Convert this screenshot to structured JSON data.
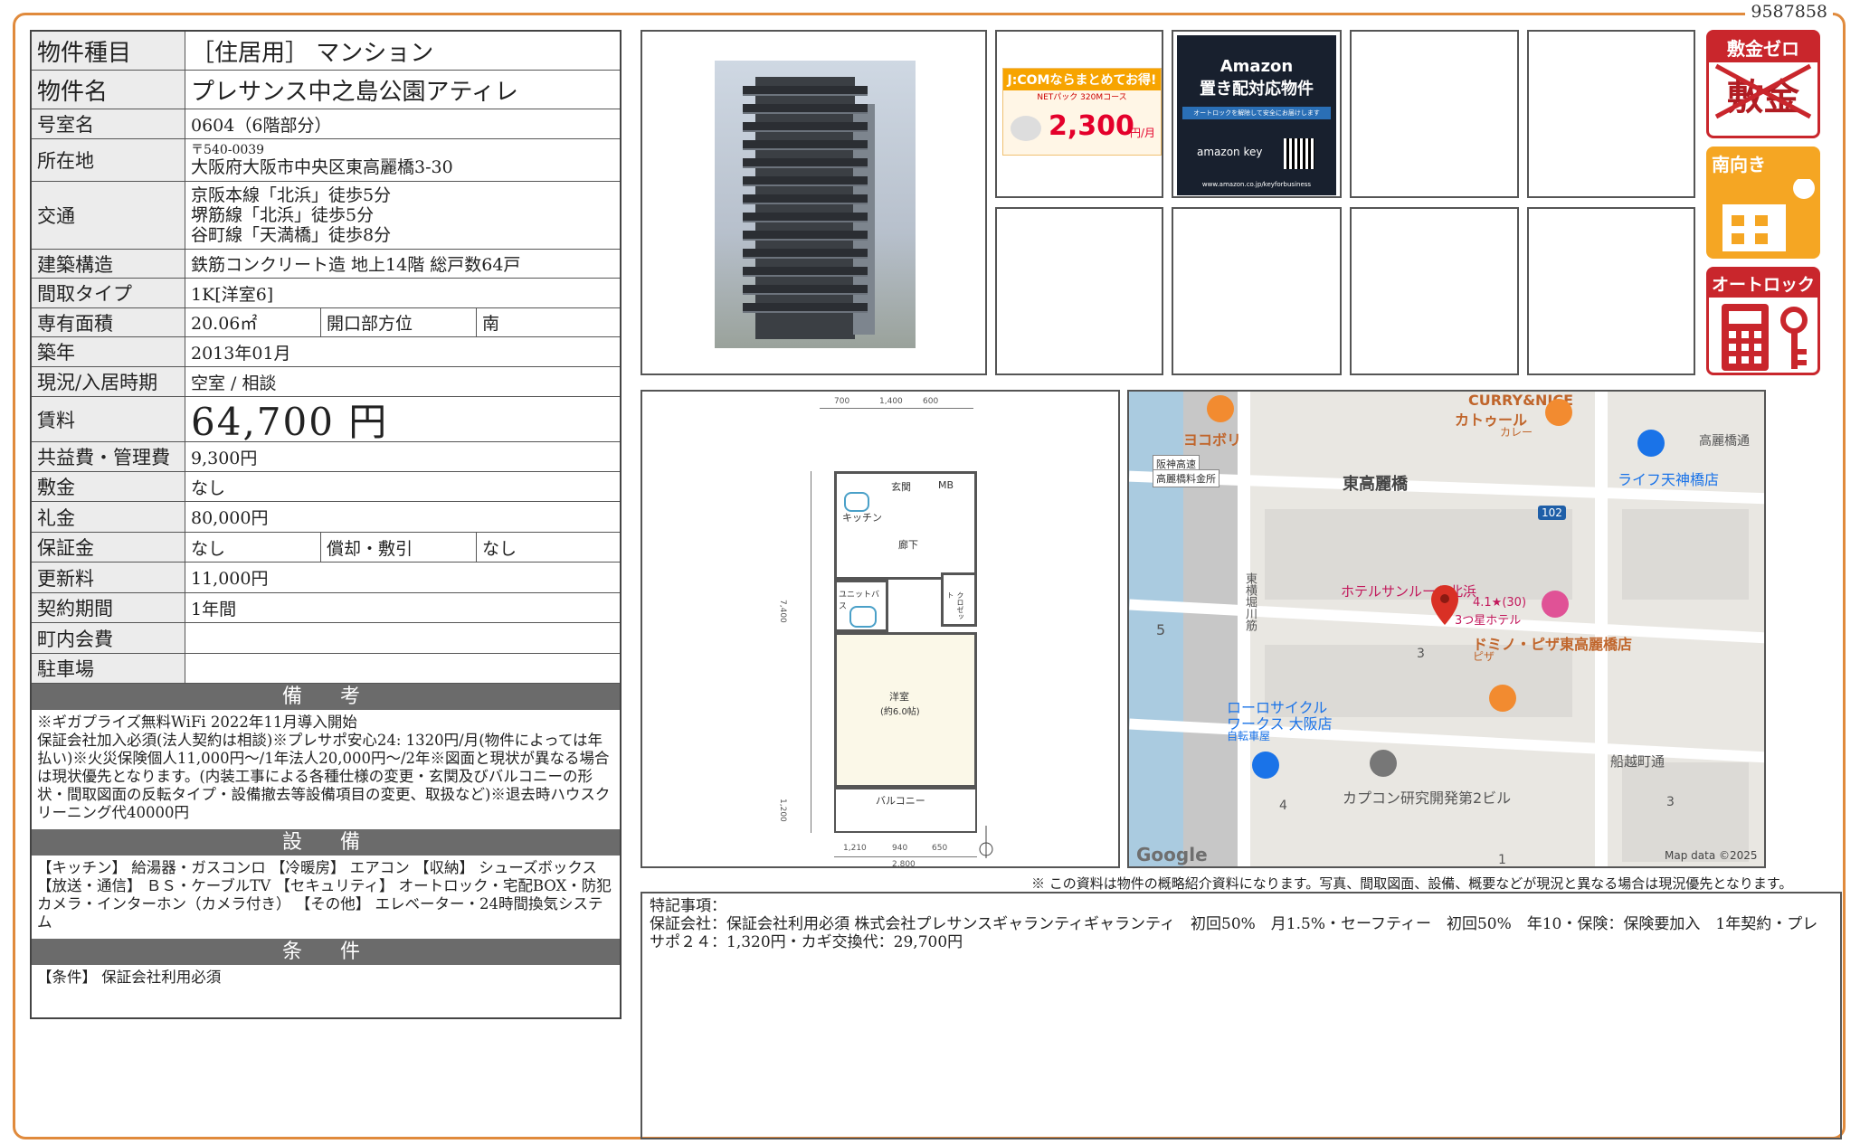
{
  "doc_id": "9587858",
  "property": {
    "type": {
      "label": "物件種目",
      "value": "［住居用］ マンション"
    },
    "name": {
      "label": "物件名",
      "value": "プレサンス中之島公園アティレ"
    },
    "room": {
      "label": "号室名",
      "value": "0604（6階部分）"
    },
    "address": {
      "label": "所在地",
      "zip": "〒540-0039",
      "value": "大阪府大阪市中央区東高麗橋3-30"
    },
    "transit": {
      "label": "交通",
      "lines": [
        "京阪本線「北浜」徒歩5分",
        "堺筋線「北浜」徒歩5分",
        "谷町線「天満橋」徒歩8分"
      ]
    },
    "structure": {
      "label": "建築構造",
      "value": "鉄筋コンクリート造 地上14階 総戸数64戸"
    },
    "layout": {
      "label": "間取タイプ",
      "value": "1K[洋室6]"
    },
    "area": {
      "label": "専有面積",
      "value": "20.06㎡",
      "dir_label": "開口部方位",
      "dir_value": "南"
    },
    "built": {
      "label": "築年",
      "value": "2013年01月"
    },
    "status": {
      "label": "現況/入居時期",
      "value": "空室 / 相談"
    },
    "rent": {
      "label": "賃料",
      "value": "64,700 円"
    },
    "fee": {
      "label": "共益費・管理費",
      "value": "9,300円"
    },
    "deposit": {
      "label": "敷金",
      "value": "なし"
    },
    "key_money": {
      "label": "礼金",
      "value": "80,000円"
    },
    "guarantee": {
      "label": "保証金",
      "value": "なし",
      "amort_label": "償却・敷引",
      "amort_value": "なし"
    },
    "renewal": {
      "label": "更新料",
      "value": "11,000円"
    },
    "term": {
      "label": "契約期間",
      "value": "1年間"
    },
    "town_fee": {
      "label": "町内会費",
      "value": ""
    },
    "parking": {
      "label": "駐車場",
      "value": ""
    }
  },
  "remarks": {
    "title": "備　考",
    "text": "※ギガプライズ無料WiFi 2022年11月導入開始\n保証会社加入必須(法人契約は相談)※プレサポ安心24: 1320円/月(物件によっては年払い)※火災保険個人11,000円〜/1年法人20,000円〜/2年※図面と現状が異なる場合は現状優先となります。(内装工事による各種仕様の変更・玄関及びバルコニーの形状・間取図面の反転タイプ・設備撤去等設備項目の変更、取扱など)※退去時ハウスクリーニング代40000円"
  },
  "equipment": {
    "title": "設　備",
    "text": "【キッチン】 給湯器・ガスコンロ 【冷暖房】 エアコン 【収納】 シューズボックス 【放送・通信】 ＢＳ・ケーブルTV 【セキュリティ】 オートロック・宅配BOX・防犯カメラ・インターホン（カメラ付き） 【その他】 エレベーター・24時間換気システム"
  },
  "conditions": {
    "title": "条　件",
    "text": "【条件】 保証会社利用必須"
  },
  "ads": {
    "jcom_title": "J:COMならまとめてお得!",
    "jcom_sub": "NETパック 320Mコース",
    "jcom_price": "2,300",
    "jcom_unit": "円/月",
    "amazon_title": "Amazon",
    "amazon_sub": "置き配対応物件",
    "amazon_note": "オートロックを解除して安全にお届けします",
    "amazon_key": "amazon key",
    "amazon_url": "www.amazon.co.jp/keyforbusiness"
  },
  "badges": {
    "zero_deposit_top": "敷金ゼロ",
    "zero_deposit_main": "敷金",
    "south": "南向き",
    "autolock": "オートロック"
  },
  "floorplan": {
    "labels": {
      "entrance": "玄関",
      "hall": "廊下",
      "kitchen": "キッチン",
      "unit_bath": "ユニットバス",
      "western": "洋室",
      "western_size": "(約6.0帖)",
      "balcony": "バルコニー",
      "closet": "クロゼット",
      "mb": "MB"
    },
    "dims": {
      "top1": "700",
      "top2": "1,400",
      "top3": "600",
      "left1": "7,400",
      "left2": "1,200",
      "bottom1": "1,210",
      "bottom2": "940",
      "bottom3": "650",
      "bottom_total": "2,800"
    }
  },
  "map": {
    "labels": [
      "CURRY&NICE",
      "カトゥール",
      "カレー",
      "ヨコボリ",
      "阪神高速",
      "高麗橋料金所",
      "東高麗橋",
      "ライフ天神橋店",
      "高麗橋通",
      "102",
      "ホテルサンルート北浜",
      "4.1★(30)",
      "3つ星ホテル",
      "東横堀川筋",
      "ドミノ・ピザ東高麗橋店",
      "ピザ",
      "ローロサイクル",
      "ワークス 大阪店",
      "自転車屋",
      "船越町通",
      "カプコン研究開発第2ビル",
      "5",
      "3",
      "4",
      "3",
      "1"
    ],
    "google": "Google",
    "attribution": "Map data ©2025"
  },
  "disclaimer": "※ この資料は物件の概略紹介資料になります。写真、間取図面、設備、概要などが現況と異なる場合は現況優先となります。",
  "special": {
    "title": "特記事項：",
    "text": "保証会社：保証会社利用必須 株式会社プレサンスギャランティギャランティ　初回50%　月1.5%・セーフティー　初回50%　年10・保険：保険要加入　1年契約・プレサポ２４：1,320円・カギ交換代：29,700円"
  },
  "colors": {
    "frame": "#e08a3c",
    "section_bg": "#6b6b6b",
    "badge_red": "#c9262c",
    "badge_orange": "#f5a623"
  }
}
